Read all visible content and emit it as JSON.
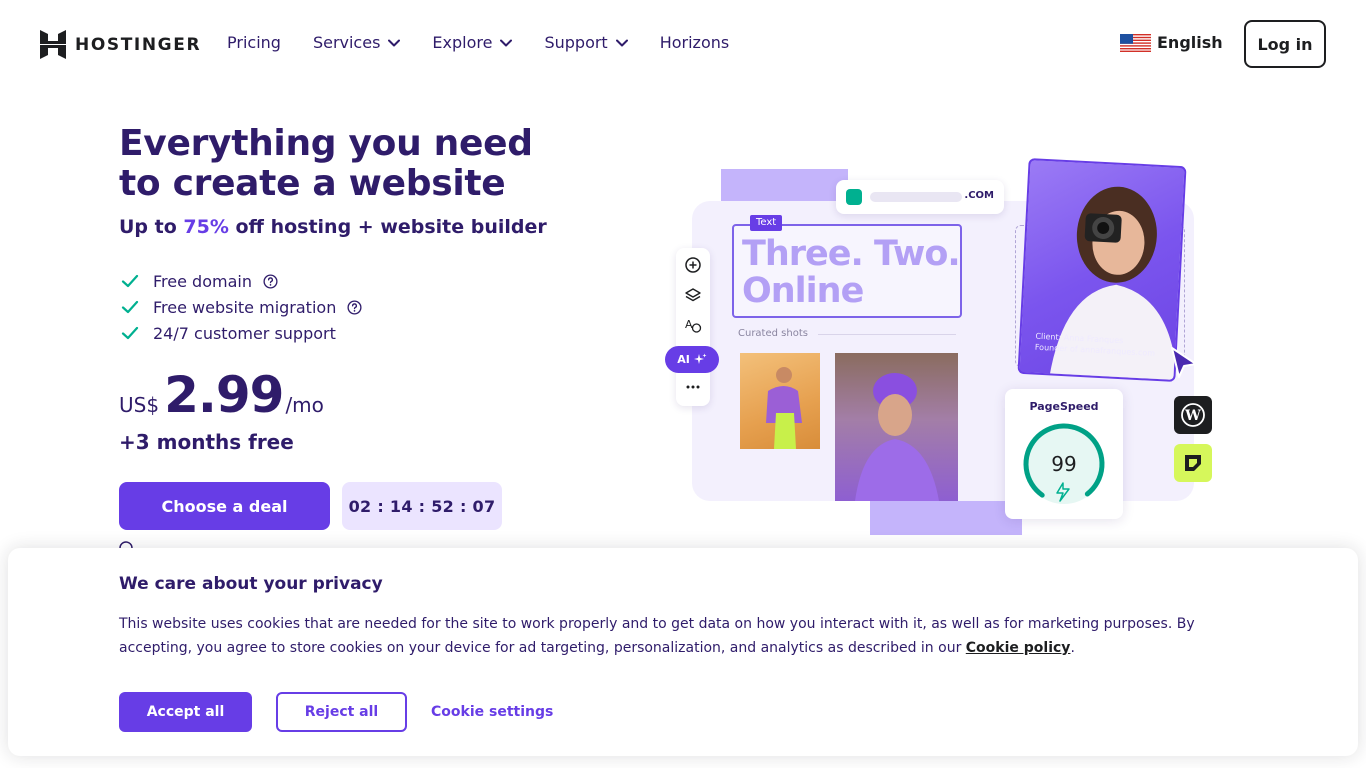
{
  "brand": {
    "name": "HOSTINGER",
    "primary_color": "#673de6",
    "text_color": "#2f1c6a",
    "logo_icon": "hostinger-logo-icon"
  },
  "nav": {
    "items": [
      {
        "label": "Pricing",
        "has_dropdown": false
      },
      {
        "label": "Services",
        "has_dropdown": true
      },
      {
        "label": "Explore",
        "has_dropdown": true
      },
      {
        "label": "Support",
        "has_dropdown": true
      },
      {
        "label": "Horizons",
        "has_dropdown": false
      }
    ],
    "language": {
      "label": "English",
      "icon": "us-flag-icon"
    },
    "login_label": "Log in"
  },
  "hero": {
    "title": "Everything you need to create a website",
    "subtitle_prefix": "Up to ",
    "subtitle_accent": "75%",
    "subtitle_suffix": " off hosting + website builder",
    "features": [
      {
        "label": "Free domain",
        "has_help": true
      },
      {
        "label": "Free website migration",
        "has_help": true
      },
      {
        "label": "24/7 customer support",
        "has_help": false
      }
    ],
    "price": {
      "currency": "US$",
      "amount": "2.99",
      "period": "/mo"
    },
    "bonus": "+3 months free",
    "cta_label": "Choose a deal",
    "countdown": "02 : 14 : 52 : 07"
  },
  "illustration": {
    "url_tld": ".COM",
    "text_badge": "Text",
    "headline_line1": "Three. Two.",
    "headline_line2": "Online",
    "curated_label": "Curated shots",
    "ai_label": "AI",
    "client_line1": "Client: Anna Franques",
    "client_line2": "Founder of annafranques.com",
    "pagespeed_label": "PageSpeed",
    "pagespeed_score": "99",
    "pagespeed_fraction": 0.99
  },
  "cookie": {
    "title": "We care about your privacy",
    "text_main": "This website uses cookies that are needed for the site to work properly and to get data on how you interact with it, as well as for marketing purposes. By accepting, you agree to store cookies on your device for ad targeting, personalization, and analytics as described in our ",
    "link_label": "Cookie policy",
    "text_end": ".",
    "accept_label": "Accept all",
    "reject_label": "Reject all",
    "settings_label": "Cookie settings"
  }
}
